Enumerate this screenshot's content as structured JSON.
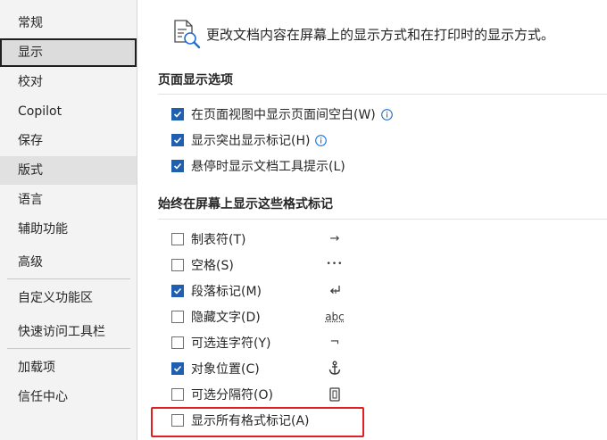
{
  "sidebar": {
    "items": [
      {
        "label": "常规",
        "name": "sidebar-item-general"
      },
      {
        "label": "显示",
        "name": "sidebar-item-display"
      },
      {
        "label": "校对",
        "name": "sidebar-item-proofing"
      },
      {
        "label": "Copilot",
        "name": "sidebar-item-copilot"
      },
      {
        "label": "保存",
        "name": "sidebar-item-save"
      },
      {
        "label": "版式",
        "name": "sidebar-item-typography"
      },
      {
        "label": "语言",
        "name": "sidebar-item-language"
      },
      {
        "label": "辅助功能",
        "name": "sidebar-item-accessibility"
      },
      {
        "label": "高级",
        "name": "sidebar-item-advanced"
      },
      {
        "label": "自定义功能区",
        "name": "sidebar-item-customize-ribbon"
      },
      {
        "label": "快速访问工具栏",
        "name": "sidebar-item-quick-access-toolbar"
      },
      {
        "label": "加载项",
        "name": "sidebar-item-add-ins"
      },
      {
        "label": "信任中心",
        "name": "sidebar-item-trust-center"
      }
    ],
    "selected": "显示"
  },
  "main": {
    "intro_text": "更改文档内容在屏幕上的显示方式和在打印时的显示方式。",
    "intro_icon": "document-magnifier-icon",
    "page_display_section": {
      "title": "页面显示选项",
      "options": [
        {
          "label": "在页面视图中显示页面间空白(W)",
          "checked": true,
          "info": true
        },
        {
          "label": "显示突出显示标记(H)",
          "checked": true,
          "info": true
        },
        {
          "label": "悬停时显示文档工具提示(L)",
          "checked": true,
          "info": false
        }
      ]
    },
    "formatting_marks_section": {
      "title": "始终在屏幕上显示这些格式标记",
      "options": [
        {
          "label": "制表符(T)",
          "checked": false,
          "symbol": "→"
        },
        {
          "label": "空格(S)",
          "checked": false,
          "symbol": "•••"
        },
        {
          "label": "段落标记(M)",
          "checked": true,
          "symbol": "paragraph-mark-icon"
        },
        {
          "label": "隐藏文字(D)",
          "checked": false,
          "symbol": "abc"
        },
        {
          "label": "可选连字符(Y)",
          "checked": false,
          "symbol": "¬"
        },
        {
          "label": "对象位置(C)",
          "checked": true,
          "symbol": "anchor-icon"
        },
        {
          "label": "可选分隔符(O)",
          "checked": false,
          "symbol": "optional-break-icon"
        },
        {
          "label": "显示所有格式标记(A)",
          "checked": false,
          "symbol": ""
        }
      ]
    }
  },
  "colors": {
    "checkbox_checked": "#1f5fb0",
    "info_icon": "#1f6fd1",
    "highlight_box": "#e02020",
    "sidebar_bg": "#f3f3f3"
  }
}
